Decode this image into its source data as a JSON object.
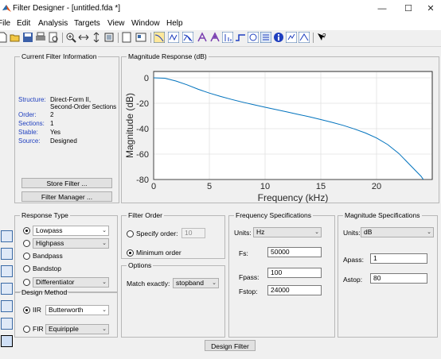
{
  "window": {
    "title": "Filter Designer - [untitled.fda *]",
    "minimize": "—",
    "maximize": "☐",
    "close": "✕"
  },
  "menu": [
    "File",
    "Edit",
    "Analysis",
    "Targets",
    "View",
    "Window",
    "Help"
  ],
  "toolbar_icons": [
    "new-icon",
    "open-icon",
    "save-icon",
    "print-icon",
    "print-preview-icon",
    "zoom-in-icon",
    "zoom-x-icon",
    "zoom-y-icon",
    "full-view-icon",
    "new-window-icon",
    "full-screen-icon",
    "magnitude-response-icon",
    "phase-response-icon",
    "magnitude-phase-icon",
    "group-delay-icon",
    "phase-delay-icon",
    "impulse-response-icon",
    "step-response-icon",
    "pole-zero-icon",
    "coefficients-icon",
    "info-icon",
    "cost-icon",
    "round-off-icon",
    "whats-this-icon"
  ],
  "filter_info": {
    "legend": "Current Filter Information",
    "rows": [
      {
        "label": "Structure:",
        "value": "Direct-Form II,"
      },
      {
        "label": "",
        "value": "Second-Order Sections"
      },
      {
        "label": "Order:",
        "value": "2"
      },
      {
        "label": "Sections:",
        "value": "1"
      },
      {
        "label": "Stable:",
        "value": "Yes"
      },
      {
        "label": "Source:",
        "value": "Designed"
      }
    ],
    "store_button": "Store Filter ...",
    "manager_button": "Filter Manager ..."
  },
  "magnitude": {
    "legend": "Magnitude Response (dB)"
  },
  "chart_data": {
    "type": "line",
    "title": "",
    "xlabel": "Frequency (kHz)",
    "ylabel": "Magnitude (dB)",
    "xlim": [
      0,
      25
    ],
    "ylim": [
      -80,
      5
    ],
    "xticks": [
      0,
      5,
      10,
      15,
      20
    ],
    "yticks": [
      0,
      -20,
      -40,
      -60,
      -80
    ],
    "grid": true,
    "line_color": "#0072bd",
    "x": [
      0,
      1,
      2,
      3,
      4,
      5,
      6,
      7,
      8,
      9,
      10,
      11,
      12,
      13,
      14,
      15,
      16,
      17,
      18,
      19,
      20,
      21,
      22,
      23,
      24,
      24.6
    ],
    "y": [
      0,
      -0.3,
      -2.5,
      -5.5,
      -9,
      -12,
      -14.6,
      -17,
      -19.2,
      -21.2,
      -23.1,
      -25,
      -26.9,
      -28.8,
      -30.7,
      -32.8,
      -35,
      -37.4,
      -40.2,
      -43.4,
      -47.3,
      -52.5,
      -59.5,
      -68.5,
      -77.5,
      -85
    ]
  },
  "response_type": {
    "legend": "Response Type",
    "options": [
      {
        "label": "Lowpass",
        "selected": true,
        "has_dropdown": true
      },
      {
        "label": "Highpass",
        "selected": false,
        "has_dropdown": true
      },
      {
        "label": "Bandpass",
        "selected": false,
        "has_dropdown": false
      },
      {
        "label": "Bandstop",
        "selected": false,
        "has_dropdown": false
      },
      {
        "label": "Differentiator",
        "selected": false,
        "has_dropdown": true
      }
    ]
  },
  "design_method": {
    "legend": "Design Method",
    "iir_label": "IIR",
    "iir_value": "Butterworth",
    "fir_label": "FIR",
    "fir_value": "Equiripple"
  },
  "filter_order": {
    "legend": "Filter Order",
    "specify_label": "Specify order:",
    "specify_value": "10",
    "minimum_label": "Minimum order"
  },
  "options": {
    "legend": "Options",
    "match_label": "Match exactly:",
    "match_value": "stopband"
  },
  "freq_spec": {
    "legend": "Frequency Specifications",
    "units_label": "Units:",
    "units_value": "Hz",
    "fs_label": "Fs:",
    "fs_value": "50000",
    "fpass_label": "Fpass:",
    "fpass_value": "100",
    "fstop_label": "Fstop:",
    "fstop_value": "24000"
  },
  "mag_spec": {
    "legend": "Magnitude Specifications",
    "units_label": "Units:",
    "units_value": "dB",
    "apass_label": "Apass:",
    "apass_value": "1",
    "astop_label": "Astop:",
    "astop_value": "80"
  },
  "design_button": "Design Filter"
}
